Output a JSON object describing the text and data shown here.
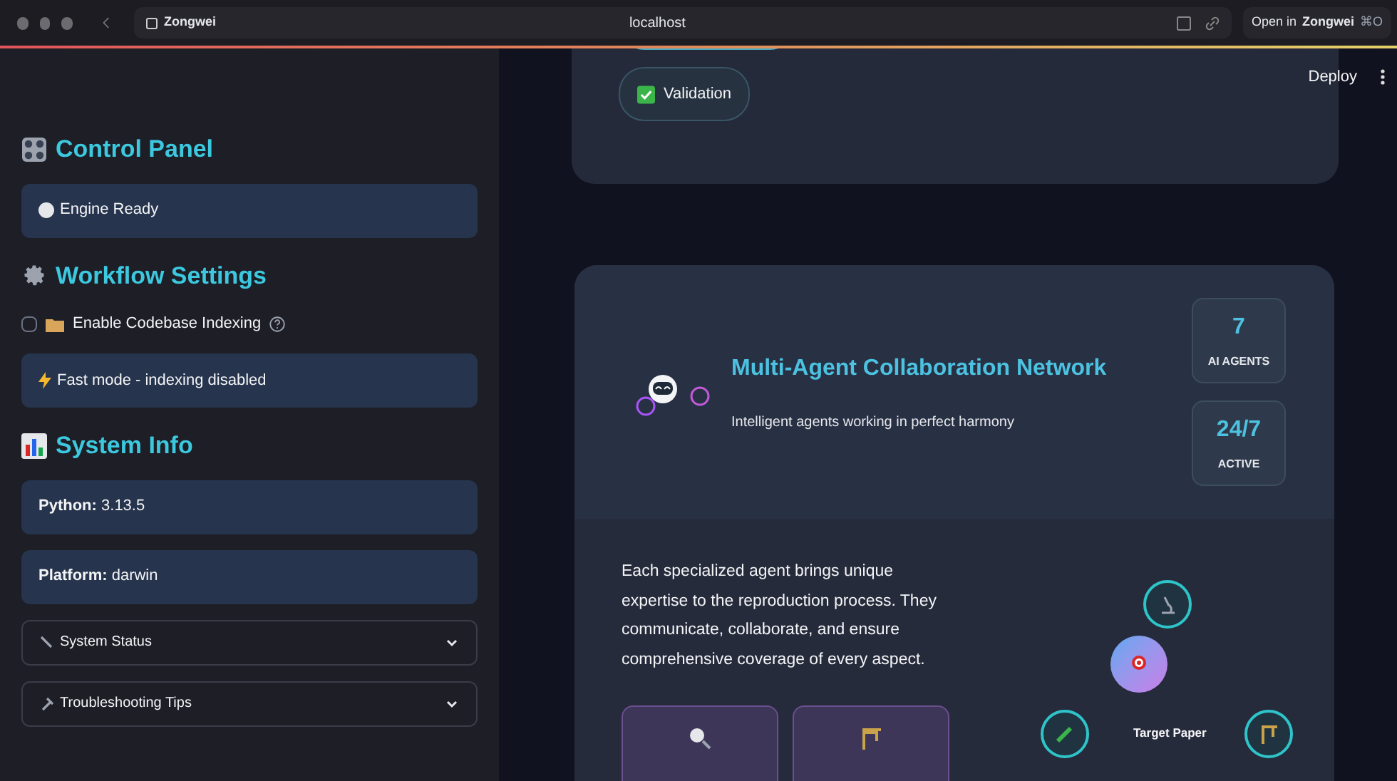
{
  "browser": {
    "site": "Zongwei",
    "url": "localhost",
    "open_in": "Open in",
    "app": "Zongwei",
    "shortcut": "⌘O"
  },
  "header": {
    "deploy": "Deploy"
  },
  "sidebar": {
    "sections": [
      {
        "kind": "controls",
        "title": "Control Panel",
        "items": [
          {
            "kind": "status",
            "text": "Engine Ready"
          }
        ]
      },
      {
        "kind": "settings",
        "title": "Workflow Settings",
        "items": [
          {
            "kind": "checkbox",
            "label": "Enable Codebase Indexing",
            "checked": false
          },
          {
            "kind": "status",
            "text": "Fast mode - indexing disabled"
          }
        ]
      },
      {
        "kind": "info",
        "title": "System Info",
        "items": [
          {
            "kind": "info",
            "label": "Python:",
            "value": "3.13.5"
          },
          {
            "kind": "info",
            "label": "Platform:",
            "value": "darwin"
          },
          {
            "kind": "expander",
            "label": "System Status",
            "expanded": false
          },
          {
            "kind": "expander",
            "label": "Troubleshooting Tips",
            "expanded": false
          }
        ]
      }
    ]
  },
  "top_card": {
    "pills": [
      {
        "label": "Validation"
      }
    ]
  },
  "network_card": {
    "title": "Multi-Agent Collaboration Network",
    "subtitle": "Intelligent agents working in perfect harmony",
    "stats": [
      {
        "value": "7",
        "label": "AI AGENTS"
      },
      {
        "value": "24/7",
        "label": "ACTIVE"
      }
    ],
    "description": "Each specialized agent brings unique expertise to the reproduction process. They communicate, collaborate, and ensure comprehensive coverage of every aspect.",
    "center_label": "Target Paper"
  }
}
